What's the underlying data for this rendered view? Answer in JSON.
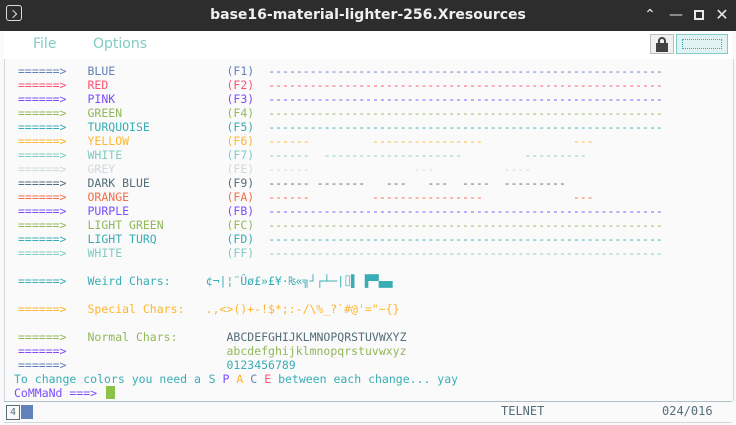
{
  "window": {
    "title": "base16-material-lighter-256.Xresources"
  },
  "menu": {
    "file": "File",
    "options": "Options"
  },
  "colors_rows": [
    {
      "arrow": "======>",
      "name": "BLUE",
      "key": "(F1)",
      "color": "#6182b8",
      "dash": "---------------------------------------------------------"
    },
    {
      "arrow": "======>",
      "name": "RED",
      "key": "(F2)",
      "color": "#ff5370",
      "dash": "---------------------------------------------------------"
    },
    {
      "arrow": "======>",
      "name": "PINK",
      "key": "(F3)",
      "color": "#7c4dff",
      "dash": "---------------------------------------------------------"
    },
    {
      "arrow": "======>",
      "name": "GREEN",
      "key": "(F4)",
      "color": "#91b859",
      "dash": "---------------------------------------------------------"
    },
    {
      "arrow": "======>",
      "name": "TURQUOISE",
      "key": "(F5)",
      "color": "#39adb5",
      "dash": "---------------------------------------------------------"
    },
    {
      "arrow": "======>",
      "name": "YELLOW",
      "key": "(F6)",
      "color": "#ffb62c",
      "dash": "------         ----------------             ---"
    },
    {
      "arrow": "======>",
      "name": "WHITE",
      "key": "(F7)",
      "color": "#80cbc4",
      "dash": "------  --------------------         ---------"
    },
    {
      "arrow": "======>",
      "name": "GREY",
      "key": "(FE)",
      "color": "#cfd8dc",
      "dash": "------               ---          ----"
    },
    {
      "arrow": "======>",
      "name": "DARK BLUE",
      "key": "(F9)",
      "color": "#546e7a",
      "dash": "------ -------   ---   ---  ----  ---------"
    },
    {
      "arrow": "======>",
      "name": "ORANGE",
      "key": "(FA)",
      "color": "#f76d47",
      "dash": "------         ----------------             ---"
    },
    {
      "arrow": "======>",
      "name": "PURPLE",
      "key": "(FB)",
      "color": "#7c4dff",
      "dash": "---------------------------------------------------------"
    },
    {
      "arrow": "======>",
      "name": "LIGHT GREEN",
      "key": "(FC)",
      "color": "#91b859",
      "dash": "---------------------------------------------------------"
    },
    {
      "arrow": "======>",
      "name": "LIGHT TURQ",
      "key": "(FD)",
      "color": "#39adb5",
      "dash": "---------------------------------------------------------"
    },
    {
      "arrow": "======>",
      "name": "WHITE",
      "key": "(FF)",
      "color": "#80cbc4",
      "dash": "---------------------------------------------------------"
    }
  ],
  "weird": {
    "arrow": "======>",
    "label": "Weird Chars:",
    "chars": "¢¬|¦¨Ûø£»£¥·₨«╗┘┌┴─|⌷▌ ▛▀▄▄"
  },
  "special": {
    "arrow": "======>",
    "label": "Special Chars:",
    "chars": ".,<>()+-!$*;:-/\\%_?`#@'=\"~{}"
  },
  "normal": {
    "arrow": "======>",
    "label": "Normal Chars:",
    "upper": "ABCDEFGHIJKLMNOPQRSTUVWXYZ",
    "lower": "abcdefghijklmnopqrstuvwxyz",
    "digits": "0123456789"
  },
  "instruction": {
    "before": "To change colors you need a ",
    "space_letters": [
      "S",
      "P",
      "A",
      "C",
      "E"
    ],
    "after": " between each change... yay"
  },
  "prompt": {
    "text": "CoMMaNd ===>"
  },
  "status": {
    "left": "4",
    "mode": "TELNET",
    "position": "024/016"
  },
  "palette": {
    "arrow_default": "#6182b8",
    "header_text": "#39adb5",
    "cursor": "#8bc34a",
    "background": "#fafafa"
  }
}
